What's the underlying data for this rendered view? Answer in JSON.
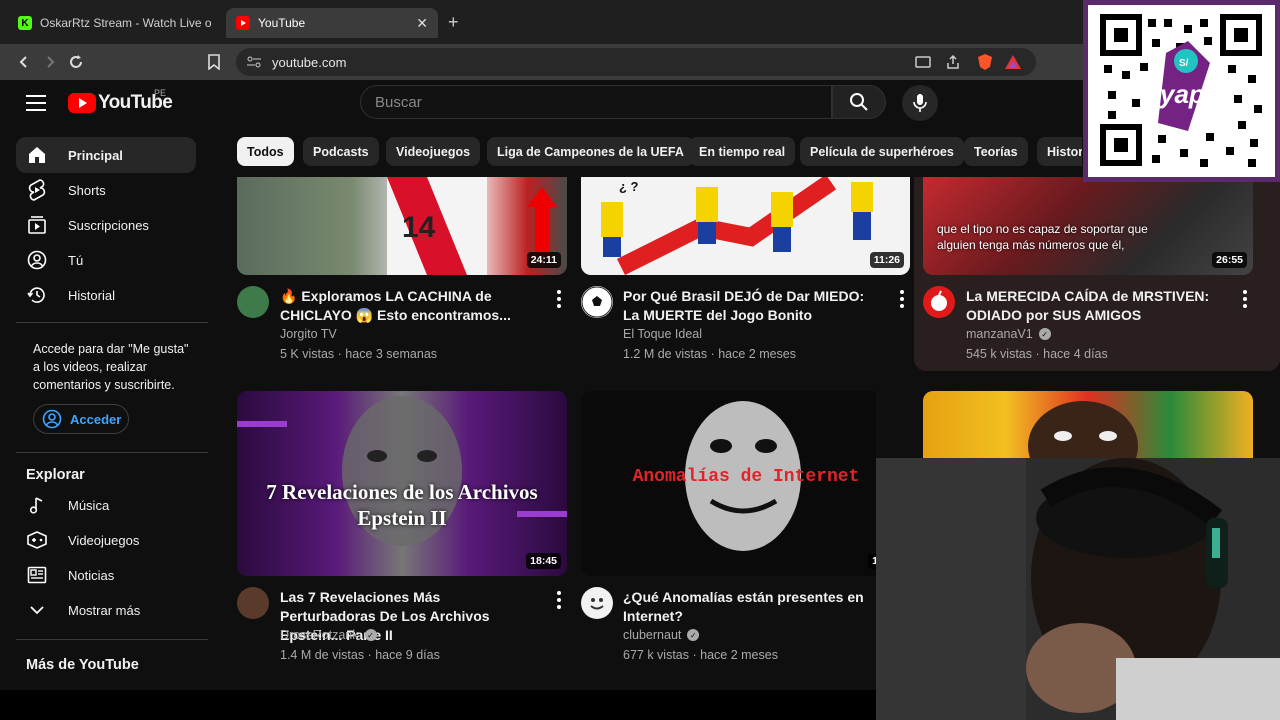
{
  "browser": {
    "tabs": [
      {
        "label": "OskarRtz Stream - Watch Live on Kick",
        "active": false
      },
      {
        "label": "YouTube",
        "active": true
      }
    ],
    "url": "youtube.com"
  },
  "youtube": {
    "logo_text": "YouTube",
    "region": "PE",
    "search_placeholder": "Buscar"
  },
  "sidebar": {
    "main_items": [
      {
        "label": "Principal",
        "icon": "home-icon",
        "active": true
      },
      {
        "label": "Shorts",
        "icon": "shorts-icon",
        "active": false
      },
      {
        "label": "Suscripciones",
        "icon": "subscriptions-icon",
        "active": false
      },
      {
        "label": "Tú",
        "icon": "you-icon",
        "active": false
      },
      {
        "label": "Historial",
        "icon": "history-icon",
        "active": false
      }
    ],
    "signin_prompt": "Accede para dar \"Me gusta\" a los videos, realizar comentarios y suscribirte.",
    "signin_button": "Acceder",
    "explore_heading": "Explorar",
    "explore_items": [
      {
        "label": "Música",
        "icon": "music-icon"
      },
      {
        "label": "Videojuegos",
        "icon": "gaming-icon"
      },
      {
        "label": "Noticias",
        "icon": "news-icon"
      },
      {
        "label": "Mostrar más",
        "icon": "chevron-down-icon"
      }
    ],
    "more_heading": "Más de YouTube"
  },
  "chips": [
    "Todos",
    "Podcasts",
    "Videojuegos",
    "Liga de Campeones de la UEFA",
    "En tiempo real",
    "Película de superhéroes",
    "Teorías",
    "Histor"
  ],
  "videos": [
    {
      "title": "🔥 Exploramos LA CACHINA de CHICLAYO 😱 Esto encontramos...",
      "channel": "Jorgito TV",
      "verified": false,
      "views": "5 K vistas",
      "age": "hace 3 semanas",
      "duration": "24:11"
    },
    {
      "title": "Por Qué Brasil DEJÓ de Dar MIEDO: La MUERTE del Jogo Bonito",
      "channel": "El Toque Ideal",
      "verified": false,
      "views": "1.2 M de vistas",
      "age": "hace 2 meses",
      "duration": "11:26",
      "thumb_text": "¿ ?"
    },
    {
      "title": "La MERECIDA CAÍDA de MRSTIVEN: ODIADO por SUS AMIGOS",
      "channel": "manzanaV1",
      "verified": true,
      "views": "545 k vistas",
      "age": "hace 4 días",
      "duration": "26:55",
      "thumb_caption": "que el tipo no es capaz de soportar que alguien tenga más números que él,"
    },
    {
      "title": "Las 7 Revelaciones Más Perturbadoras De Los Archivos Epstein... Parte II",
      "channel": "DrossRotzank",
      "verified": true,
      "views": "1.4 M de vistas",
      "age": "hace 9 días",
      "duration": "18:45",
      "thumb_text": "7 Revelaciones de los Archivos Epstein II"
    },
    {
      "title": "¿Qué Anomalías están presentes en Internet?",
      "channel": "clubernaut",
      "verified": true,
      "views": "677 k vistas",
      "age": "hace 2 meses",
      "duration": "1",
      "thumb_text": "Anomalías de Internet"
    }
  ],
  "overlay": {
    "qr_brand": "yape",
    "qr_badge": "S/"
  },
  "colors": {
    "background": "#0f0f0f",
    "youtube_red": "#ff0000",
    "link_blue": "#3ea6ff",
    "qr_frame": "#5a2a6a"
  }
}
